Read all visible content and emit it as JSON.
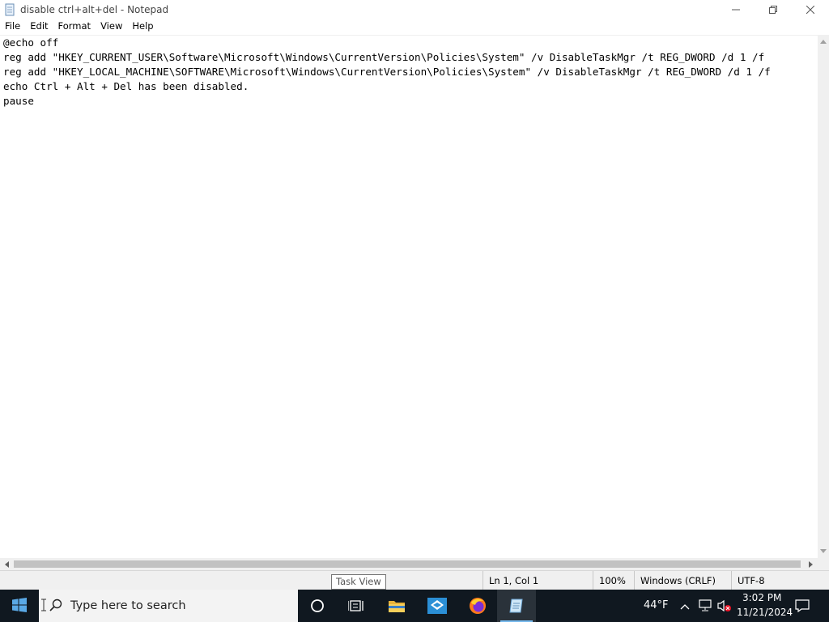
{
  "window": {
    "title": "disable ctrl+alt+del - Notepad",
    "icon": "notepad-icon",
    "controls": [
      "minimize-icon",
      "restore-icon",
      "close-icon"
    ]
  },
  "menu": {
    "items": [
      "File",
      "Edit",
      "Format",
      "View",
      "Help"
    ]
  },
  "editor": {
    "lines": [
      "@echo off",
      "reg add \"HKEY_CURRENT_USER\\Software\\Microsoft\\Windows\\CurrentVersion\\Policies\\System\" /v DisableTaskMgr /t REG_DWORD /d 1 /f",
      "reg add \"HKEY_LOCAL_MACHINE\\SOFTWARE\\Microsoft\\Windows\\CurrentVersion\\Policies\\System\" /v DisableTaskMgr /t REG_DWORD /d 1 /f",
      "echo Ctrl + Alt + Del has been disabled.",
      "pause"
    ]
  },
  "statusbar": {
    "tooltip": "Task View",
    "position": "Ln 1, Col 1",
    "zoom": "100%",
    "line_ending": "Windows (CRLF)",
    "encoding": "UTF-8"
  },
  "taskbar": {
    "search_placeholder": "Type here to search",
    "pinned": [
      "cortana-icon",
      "task-view-icon",
      "file-explorer-icon",
      "mail-app-icon",
      "firefox-icon",
      "notepad-icon"
    ],
    "weather": "44°F",
    "time": "3:02 PM",
    "date": "11/21/2024",
    "accent": "#76b9ed"
  }
}
